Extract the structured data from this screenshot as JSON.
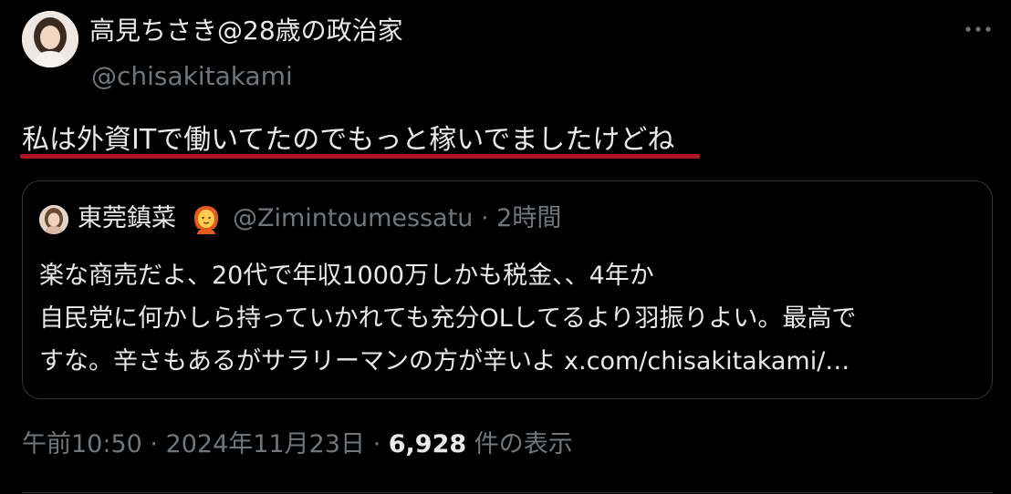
{
  "tweet": {
    "author": {
      "display_name": "高見ちさき@28歳の政治家",
      "handle": "@chisakitakami"
    },
    "more_icon": "more-horizontal-icon",
    "text": "私は外資ITで働いてたのでもっと稼いでましたけどね",
    "highlight_color": "#b01525"
  },
  "quote": {
    "author": {
      "display_name": "東莞鎮菜",
      "emoji": "person-emoji",
      "handle_time": "@Zimintoumessatu · 2時間"
    },
    "lines": [
      "楽な商売だよ、20代で年収1000万しかも税金、、4年か",
      "自民党に何かしら持っていかれても充分OLしてるより羽振りよい。最高で",
      "すな。辛さもあるがサラリーマンの方が辛いよ x.com/chisakitakami/…"
    ]
  },
  "meta": {
    "time_date": "午前10:50 · 2024年11月23日 · ",
    "views_count": "6,928",
    "views_label": " 件の表示"
  },
  "colors": {
    "background": "#000000",
    "text_primary": "#e7e9ea",
    "text_secondary": "#71767b",
    "border": "#2f3336"
  }
}
